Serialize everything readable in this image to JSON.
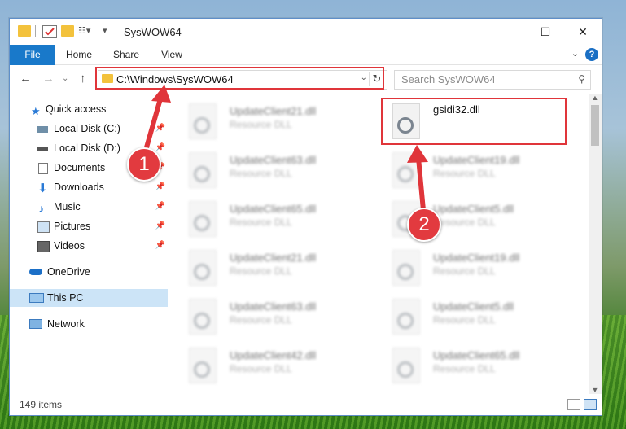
{
  "window": {
    "title": "SysWOW64",
    "controls": {
      "minimize": "—",
      "maximize": "☐",
      "close": "✕"
    }
  },
  "ribbon": {
    "tabs": [
      "File",
      "Home",
      "Share",
      "View"
    ],
    "help": "?"
  },
  "address": {
    "path": "C:\\Windows\\SysWOW64",
    "search_placeholder": "Search SysWOW64"
  },
  "nav": {
    "items": [
      {
        "label": "Quick access",
        "icon": "star-icon"
      },
      {
        "label": "Local Disk (C:)",
        "icon": "drive-icon",
        "pinned": true
      },
      {
        "label": "Local Disk (D:)",
        "icon": "drive-icon",
        "pinned": true
      },
      {
        "label": "Documents",
        "icon": "document-icon",
        "pinned": true
      },
      {
        "label": "Downloads",
        "icon": "download-icon",
        "pinned": true
      },
      {
        "label": "Music",
        "icon": "music-icon",
        "pinned": true
      },
      {
        "label": "Pictures",
        "icon": "pictures-icon",
        "pinned": true
      },
      {
        "label": "Videos",
        "icon": "video-icon",
        "pinned": true
      },
      {
        "label": "OneDrive",
        "icon": "cloud-icon"
      },
      {
        "label": "This PC",
        "icon": "computer-icon",
        "selected": true
      },
      {
        "label": "Network",
        "icon": "network-icon"
      }
    ]
  },
  "files": {
    "column_a": [
      {
        "name": "UpdateClient21.dll",
        "type": "Resource DLL"
      },
      {
        "name": "UpdateClient63.dll",
        "type": "Resource DLL"
      },
      {
        "name": "UpdateClient65.dll",
        "type": "Resource DLL"
      },
      {
        "name": "UpdateClient21.dll",
        "type": "Resource DLL"
      },
      {
        "name": "UpdateClient63.dll",
        "type": "Resource DLL"
      },
      {
        "name": "UpdateClient42.dll",
        "type": "Resource DLL"
      }
    ],
    "column_b": [
      {
        "name": "gsidi32.dll",
        "type": ""
      },
      {
        "name": "UpdateClient19.dll",
        "type": "Resource DLL"
      },
      {
        "name": "UpdateClient5.dll",
        "type": "Resource DLL"
      },
      {
        "name": "UpdateClient19.dll",
        "type": "Resource DLL"
      },
      {
        "name": "UpdateClient5.dll",
        "type": "Resource DLL"
      },
      {
        "name": "UpdateClient65.dll",
        "type": "Resource DLL"
      }
    ]
  },
  "status": {
    "item_count": "149 items"
  },
  "annotations": {
    "step1": "1",
    "step2": "2"
  },
  "colors": {
    "accent": "#1979ca",
    "annotation_red": "#e0353a",
    "selected_bg": "#cce4f7"
  }
}
